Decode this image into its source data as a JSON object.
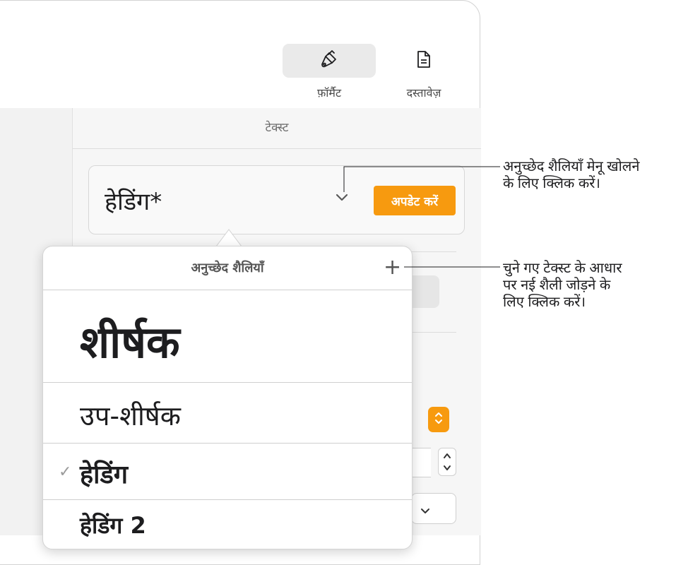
{
  "toolbar": {
    "format_label": "फ़ॉर्मैट",
    "document_label": "दस्तावेज़"
  },
  "inspector": {
    "section_title": "टेक्स्ट",
    "paragraph_style": {
      "current": "हेडिंग*",
      "update_button": "अपडेट करें"
    }
  },
  "popover": {
    "title": "अनुच्छेद शैलियाँ",
    "add_symbol": "+",
    "styles": [
      {
        "label": "शीर्षक",
        "checked": false
      },
      {
        "label": "उप-शीर्षक",
        "checked": false
      },
      {
        "label": "हेडिंग",
        "checked": true
      },
      {
        "label": "हेडिंग 2",
        "checked": false
      }
    ],
    "check_symbol": "✓"
  },
  "callouts": {
    "menu": "अनुच्छेद शैलियाँ मेनू खोलने\nके लिए क्लिक करें।",
    "add": "चुने गए टेक्स्ट के आधार\nपर नई शैली जोड़ने के\nलिए क्लिक करें।"
  },
  "colors": {
    "accent": "#F79A0F"
  },
  "icons": {
    "format": "paintbrush-icon",
    "document": "document-icon",
    "menu": "chevron-down-icon",
    "add": "plus-icon"
  }
}
